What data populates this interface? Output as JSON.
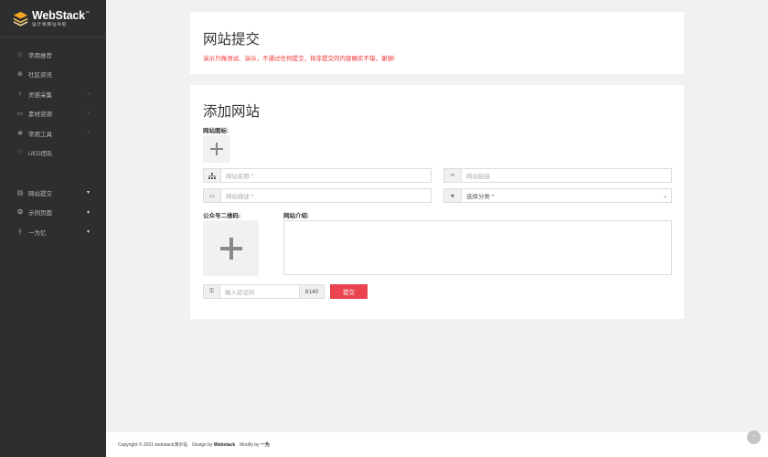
{
  "logo": {
    "title": "WebStack",
    "badge": "cc",
    "subtitle": "设计师网址导航"
  },
  "nav": {
    "group1": [
      {
        "label": "常用推荐",
        "icon": "star-icon",
        "glyph": "☆",
        "chevron": ""
      },
      {
        "label": "社区资讯",
        "icon": "globe-icon",
        "glyph": "⊕",
        "chevron": ""
      },
      {
        "label": "灵感采集",
        "icon": "bulb-icon",
        "glyph": "♁",
        "chevron": "›"
      },
      {
        "label": "素材资源",
        "icon": "folder-icon",
        "glyph": "▭",
        "chevron": "›"
      },
      {
        "label": "常用工具",
        "icon": "gear-icon",
        "glyph": "✻",
        "chevron": "›"
      },
      {
        "label": "UED团队",
        "icon": "heart-icon",
        "glyph": "♡",
        "chevron": ""
      }
    ],
    "group2": [
      {
        "label": "网站提交",
        "icon": "grid-icon",
        "glyph": "▤",
        "caret": "▾"
      },
      {
        "label": "示例页面",
        "icon": "layers-icon",
        "glyph": "❂",
        "caret": "▾"
      },
      {
        "label": "一为忆",
        "icon": "user-icon",
        "glyph": "ﾁ",
        "caret": "▾"
      }
    ]
  },
  "header": {
    "title": "网站提交",
    "notice": "演示只做测试、演示，不通过任何提交，将非提交的内容确实不错，谢谢!"
  },
  "form": {
    "title": "添加网站",
    "icon_label": "网站图标:",
    "name_placeholder": "网站名称 *",
    "link_placeholder": "网站链接",
    "desc_placeholder": "网站描述 *",
    "category_placeholder": "选择分类 *",
    "qr_label": "公众号二维码:",
    "intro_label": "网站介绍:",
    "captcha_placeholder": "输入验证码",
    "captcha_code": "8140",
    "submit_label": "提交"
  },
  "footer": {
    "copyright": "Copyright © 2021 webstack演示站",
    "design_by": "Design by",
    "design_name": "Webstack",
    "modify_by": "Modify by",
    "modify_name": "一为"
  }
}
